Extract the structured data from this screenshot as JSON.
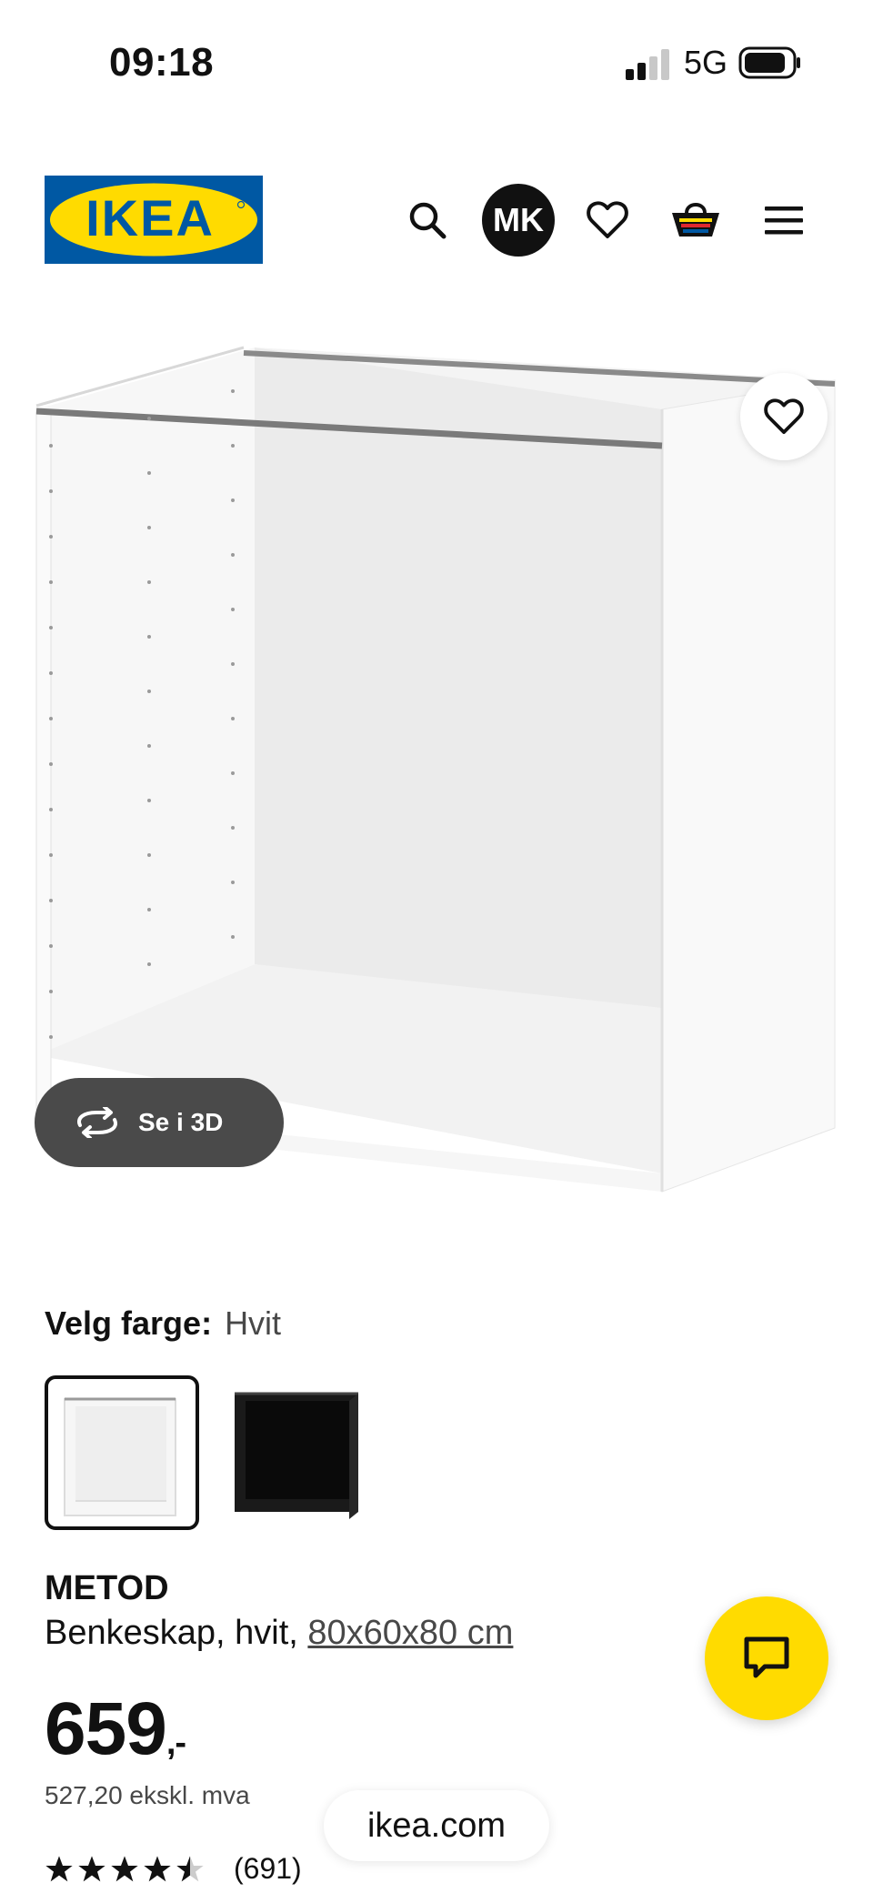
{
  "status_bar": {
    "time": "09:18",
    "network": "5G",
    "signal_bars_active": 2,
    "signal_bars_total": 4
  },
  "header": {
    "logo_text": "IKEA",
    "avatar_initials": "MK",
    "icons": [
      "search-icon",
      "heart-icon",
      "basket-icon",
      "menu-icon"
    ]
  },
  "media": {
    "view_3d_label": "Se i 3D"
  },
  "color_selector": {
    "label": "Velg farge:",
    "selected": "Hvit",
    "options": [
      "white",
      "black"
    ]
  },
  "product": {
    "name": "METOD",
    "description": "Benkeskap, hvit, ",
    "dimensions": "80x60x80 cm",
    "price": "659",
    "price_suffix": ",-",
    "price_ex_vat": "527,20 ekskl. mva",
    "rating_stars": 4.5,
    "rating_count": "(691)"
  },
  "browser": {
    "url": "ikea.com"
  },
  "colors": {
    "ikea_blue": "#0058a3",
    "ikea_yellow": "#ffdb00",
    "text": "#111111"
  }
}
